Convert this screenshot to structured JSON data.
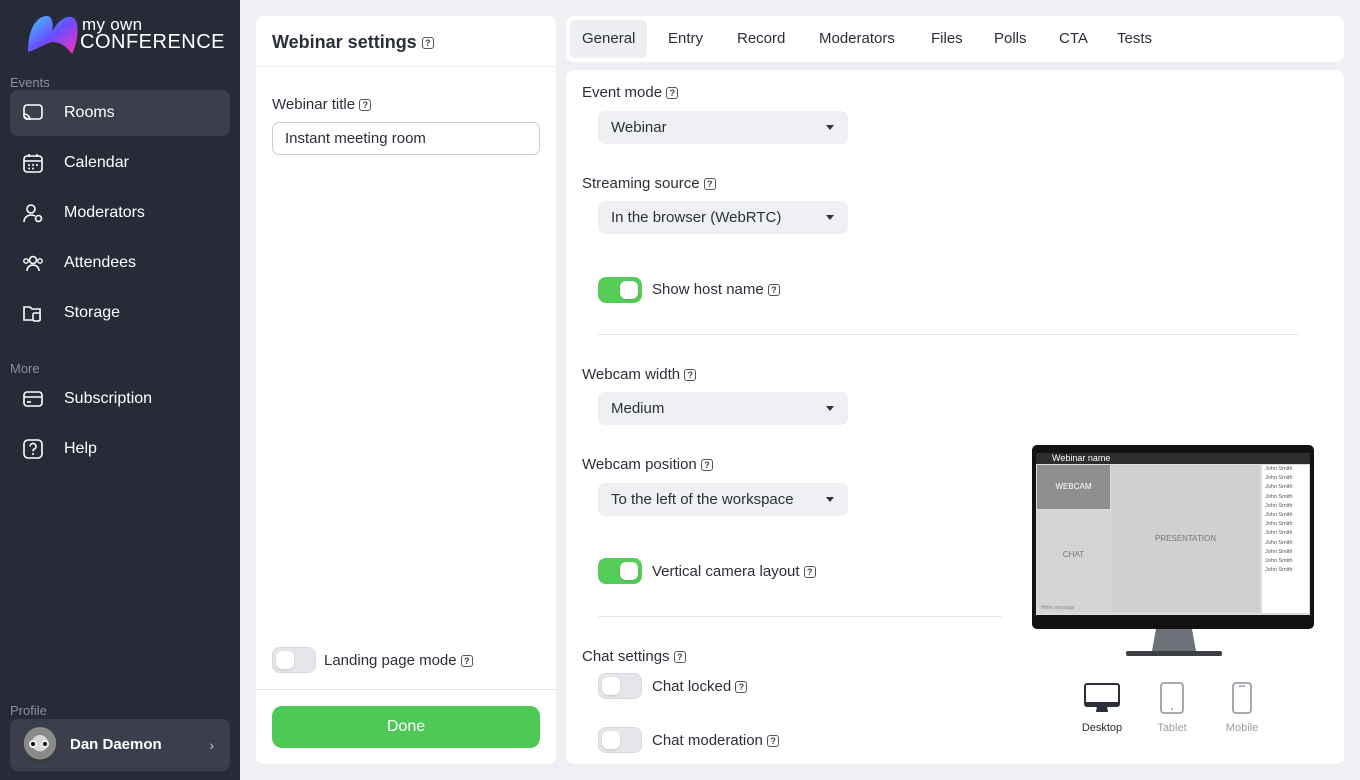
{
  "brand": {
    "line1": "my own",
    "line2": "CONFERENCE"
  },
  "sidebar": {
    "events_label": "Events",
    "items": [
      {
        "label": "Rooms",
        "icon": "cast-icon"
      },
      {
        "label": "Calendar",
        "icon": "calendar-icon"
      },
      {
        "label": "Moderators",
        "icon": "moderator-icon"
      },
      {
        "label": "Attendees",
        "icon": "attendees-icon"
      },
      {
        "label": "Storage",
        "icon": "storage-icon"
      }
    ],
    "more_label": "More",
    "more_items": [
      {
        "label": "Subscription",
        "icon": "card-icon"
      },
      {
        "label": "Help",
        "icon": "help-icon"
      }
    ],
    "profile_label": "Profile",
    "profile_name": "Dan Daemon"
  },
  "left_panel": {
    "title": "Webinar settings",
    "webinar_title_label": "Webinar title",
    "webinar_title_value": "Instant meeting room",
    "landing_page_label": "Landing page mode",
    "landing_page_on": false,
    "done_label": "Done"
  },
  "tabs": [
    "General",
    "Entry",
    "Record",
    "Moderators",
    "Files",
    "Polls",
    "CTA",
    "Tests"
  ],
  "active_tab": "General",
  "settings": {
    "event_mode_label": "Event mode",
    "event_mode_value": "Webinar",
    "streaming_source_label": "Streaming source",
    "streaming_source_value": "In the browser (WebRTC)",
    "show_host_name_label": "Show host name",
    "show_host_name_on": true,
    "webcam_width_label": "Webcam width",
    "webcam_width_value": "Medium",
    "webcam_position_label": "Webcam position",
    "webcam_position_value": "To the left of the workspace",
    "vertical_camera_label": "Vertical camera layout",
    "vertical_camera_on": true,
    "chat_settings_label": "Chat settings",
    "chat_locked_label": "Chat locked",
    "chat_locked_on": false,
    "chat_moderation_label": "Chat moderation",
    "chat_moderation_on": false
  },
  "preview": {
    "webinar_name": "Webinar name",
    "webcam": "WEBCAM",
    "chat": "CHAT",
    "presentation": "PRESENTATION",
    "write_message": "Write message",
    "users": [
      "John Smith",
      "John Smith",
      "John Smith",
      "John Smith",
      "John Smith",
      "John Smith",
      "John Smith",
      "John Smith",
      "John Smith",
      "John Smith",
      "John Smith",
      "John Smith"
    ],
    "devices": [
      "Desktop",
      "Tablet",
      "Mobile"
    ],
    "active_device": "Desktop"
  },
  "colors": {
    "sidebar_bg": "#262b37",
    "accent_green": "#4fc955",
    "page_bg": "#eef0f3"
  }
}
